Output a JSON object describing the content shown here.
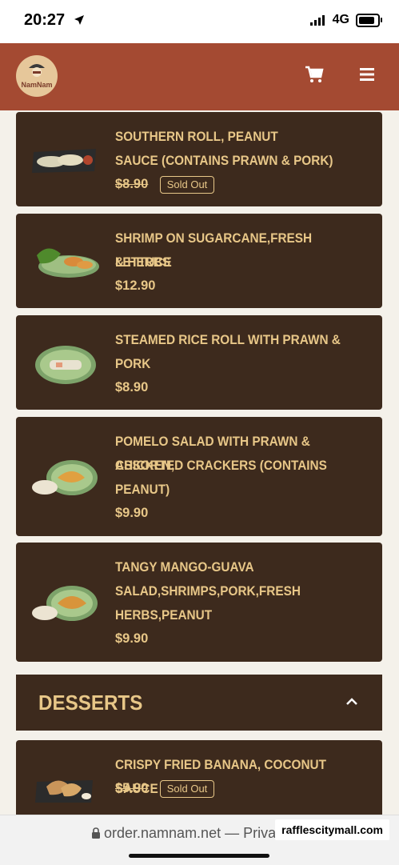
{
  "status_bar": {
    "time": "20:27",
    "network": "4G",
    "battery_level": 0.85
  },
  "header": {
    "logo_text": "NamNam"
  },
  "menu_items": [
    {
      "name_lines": [
        "SOUTHERN ROLL, PEANUT",
        "SAUCE (CONTAINS PRAWN & PORK)"
      ],
      "price": "$8.90",
      "sold_out": true,
      "sold_label": "Sold Out",
      "thumb": "spring-roll-plate-icon"
    },
    {
      "name_lines": [
        "SHRIMP ON SUGARCANE,FRESH LETTUCE",
        "& HERBS"
      ],
      "price": "$12.90",
      "sold_out": false,
      "thumb": "shrimp-plate-icon"
    },
    {
      "name_lines": [
        "STEAMED RICE ROLL WITH PRAWN &",
        "PORK"
      ],
      "price": "$8.90",
      "sold_out": false,
      "thumb": "rice-roll-plate-icon"
    },
    {
      "name_lines": [
        "POMELO SALAD WITH PRAWN & CHICKEN,",
        "ASSORTED CRACKERS (CONTAINS",
        "PEANUT)"
      ],
      "price": "$9.90",
      "sold_out": false,
      "thumb": "salad-plate-icon"
    },
    {
      "name_lines": [
        "TANGY MANGO-GUAVA",
        "SALAD,SHRIMPS,PORK,FRESH",
        "HERBS,PEANUT"
      ],
      "price": "$9.90",
      "sold_out": false,
      "thumb": "salad-plate-icon"
    }
  ],
  "section": {
    "title": "DESSERTS"
  },
  "dessert_items": [
    {
      "name_lines": [
        "CRISPY FRIED BANANA, COCONUT SAUCE"
      ],
      "price": "$5.90",
      "sold_out": true,
      "sold_label": "Sold Out",
      "thumb": "fried-banana-plate-icon"
    }
  ],
  "browser": {
    "url": "order.namnam.net — Private"
  },
  "watermark": "rafflescitymall.com",
  "colors": {
    "header": "#a44a32",
    "card": "#3d2a1d",
    "text": "#e8c788",
    "page": "#f4f1ea"
  }
}
